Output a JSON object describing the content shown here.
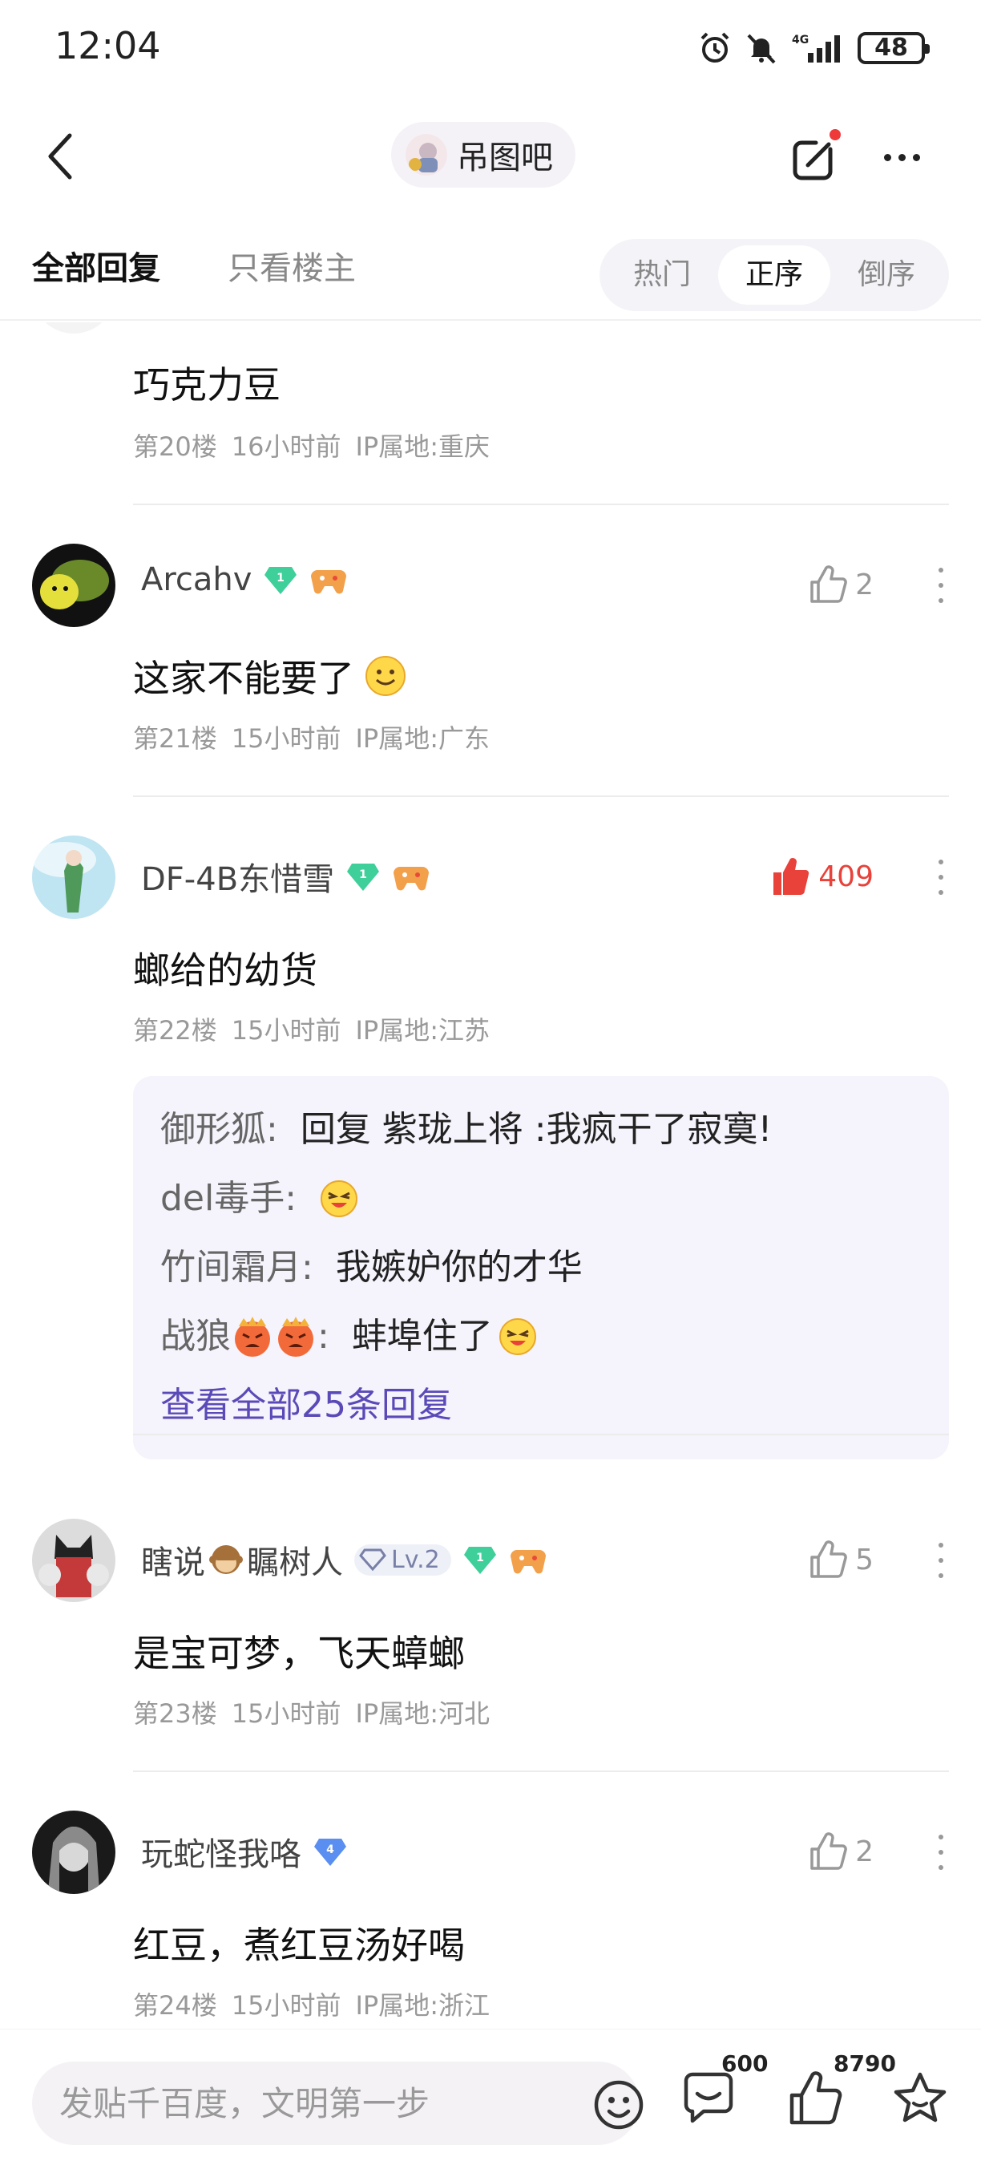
{
  "status_bar": {
    "time": "12:04",
    "network": "4G",
    "battery": "48"
  },
  "nav": {
    "forum_name": "吊图吧"
  },
  "tabs": {
    "all": "全部回复",
    "op_only": "只看楼主"
  },
  "sort": {
    "hot": "热门",
    "asc": "正序",
    "desc": "倒序"
  },
  "posts": [
    {
      "text": "巧克力豆",
      "floor": "第20楼",
      "time": "16小时前",
      "ip": "IP属地:重庆"
    },
    {
      "user": "Arcahv",
      "level": "1",
      "likes": "2",
      "text": "这家不能要了",
      "floor": "第21楼",
      "time": "15小时前",
      "ip": "IP属地:广东"
    },
    {
      "user": "DF-4B东惜雪",
      "level": "1",
      "likes": "409",
      "text": "螂给的幼货",
      "floor": "第22楼",
      "time": "15小时前",
      "ip": "IP属地:江苏",
      "replies": [
        {
          "user": "御形狐",
          "sep": ":",
          "text": "回复 紫珑上将 :我疯干了寂寞!"
        },
        {
          "user": "del毒手",
          "sep": ":",
          "text": ""
        },
        {
          "user": "竹间霜月",
          "sep": ":",
          "text": "我嫉妒你的才华"
        },
        {
          "user": "战狼",
          "sep": ":",
          "text": "蚌埠住了"
        }
      ],
      "view_all": "查看全部25条回复"
    },
    {
      "user_a": "瞎说",
      "user_b": "瞩树人",
      "badge": "Lv.2",
      "level": "1",
      "likes": "5",
      "text": "是宝可梦，飞天蟑螂",
      "floor": "第23楼",
      "time": "15小时前",
      "ip": "IP属地:河北"
    },
    {
      "user": "玩蛇怪我咯",
      "level": "4",
      "likes": "2",
      "text": "红豆，煮红豆汤好喝",
      "floor": "第24楼",
      "time": "15小时前",
      "ip": "IP属地:浙江"
    }
  ],
  "bottom": {
    "placeholder": "发贴千百度，文明第一步",
    "comments": "600",
    "likes": "8790"
  },
  "colors": {
    "accent": "#5a4ab8",
    "hot_like": "#e8423a",
    "gem_green": "#3fcf9a",
    "gem_blue": "#5a8ef0"
  }
}
